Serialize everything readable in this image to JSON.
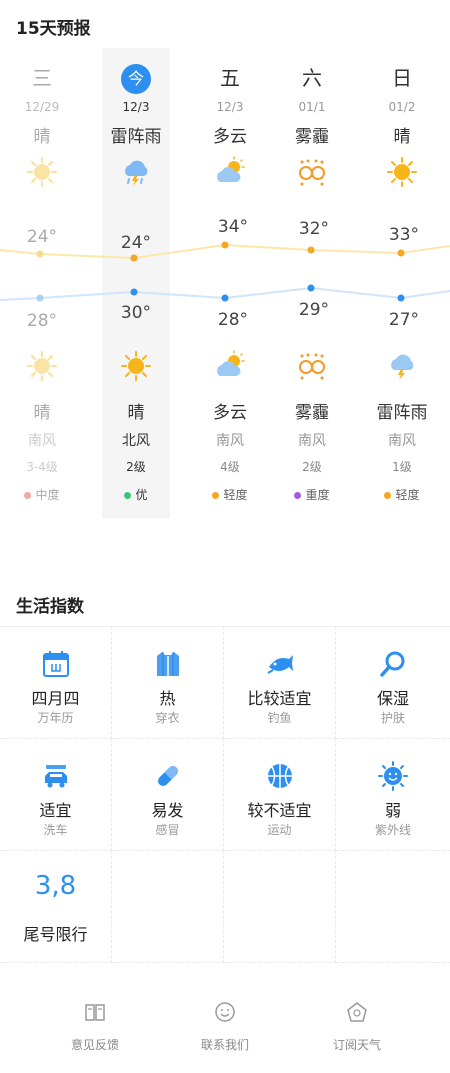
{
  "forecast": {
    "title": "15天预报",
    "days": [
      {
        "weekday": "三",
        "date": "12/29",
        "cond_day": "晴",
        "high": "24°",
        "low": "28°",
        "cond_night": "晴",
        "wind": "南风",
        "wind_level": "3-4级",
        "aqi": "中度",
        "aqi_color": "#f3a7a7",
        "icon_day": "sun-icon",
        "icon_night": "sun-icon",
        "past": true
      },
      {
        "weekday": "今",
        "date": "12/3",
        "cond_day": "雷阵雨",
        "high": "24°",
        "low": "30°",
        "cond_night": "晴",
        "wind": "北风",
        "wind_level": "2级",
        "aqi": "优",
        "aqi_color": "#3cc27a",
        "icon_day": "thunderstorm-icon",
        "icon_night": "sun-icon",
        "today": true
      },
      {
        "weekday": "五",
        "date": "12/3",
        "cond_day": "多云",
        "high": "34°",
        "low": "28°",
        "cond_night": "多云",
        "wind": "南风",
        "wind_level": "4级",
        "aqi": "轻度",
        "aqi_color": "#f5a623",
        "icon_day": "cloudy-icon",
        "icon_night": "cloudy-icon"
      },
      {
        "weekday": "六",
        "date": "01/1",
        "cond_day": "雾霾",
        "high": "32°",
        "low": "29°",
        "cond_night": "雾霾",
        "wind": "南风",
        "wind_level": "2级",
        "aqi": "重度",
        "aqi_color": "#a45cd6",
        "icon_day": "haze-icon",
        "icon_night": "haze-icon"
      },
      {
        "weekday": "日",
        "date": "01/2",
        "cond_day": "晴",
        "high": "33°",
        "low": "27°",
        "cond_night": "雷阵雨",
        "wind": "南风",
        "wind_level": "1级",
        "aqi": "轻度",
        "aqi_color": "#f5a623",
        "icon_day": "sun-icon",
        "icon_night": "thunderstorm-icon"
      }
    ],
    "high_line_color": "#f5a623",
    "low_line_color": "#2d8ff0"
  },
  "life": {
    "title": "生活指数",
    "items": [
      {
        "value": "四月四",
        "label": "万年历",
        "icon": "calendar-icon"
      },
      {
        "value": "热",
        "label": "穿衣",
        "icon": "shirt-icon"
      },
      {
        "value": "比较适宜",
        "label": "钓鱼",
        "icon": "fish-icon"
      },
      {
        "value": "保湿",
        "label": "护肤",
        "icon": "magnifier-icon"
      },
      {
        "value": "适宜",
        "label": "洗车",
        "icon": "car-icon"
      },
      {
        "value": "易发",
        "label": "感冒",
        "icon": "pill-icon"
      },
      {
        "value": "较不适宜",
        "label": "运动",
        "icon": "basketball-icon"
      },
      {
        "value": "弱",
        "label": "紫外线",
        "icon": "sun-face-icon"
      }
    ],
    "plate": {
      "value": "3,8",
      "label": "尾号限行"
    }
  },
  "footer": {
    "feedback": "意见反馈",
    "contact": "联系我们",
    "subscribe": "订阅天气"
  },
  "colors": {
    "accent": "#2d8ff0",
    "sun": "#f7b51c"
  }
}
